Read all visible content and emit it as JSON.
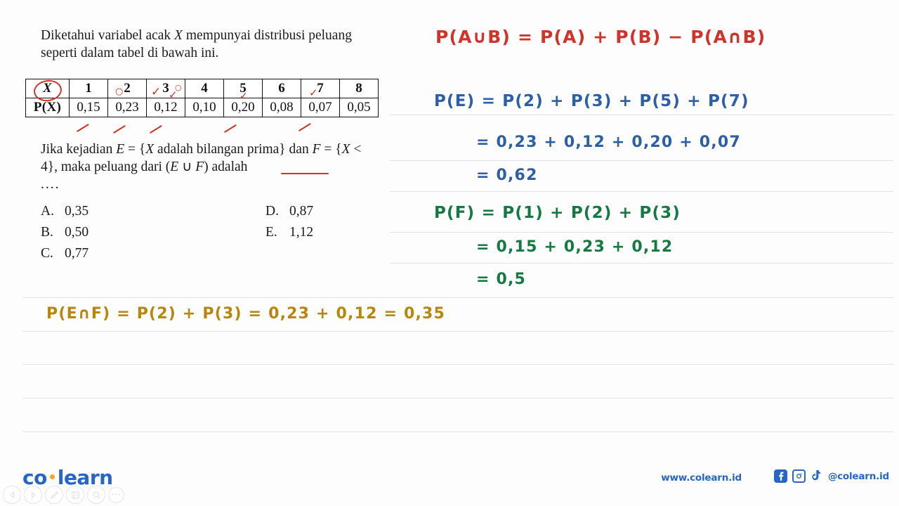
{
  "question": {
    "line1_pre": "Diketahui variabel acak ",
    "line1_var": "X",
    "line1_post": " mempunyai distribusi",
    "line2": "peluang seperti dalam tabel di bawah ini.",
    "prompt_line1_a": "Jika kejadian ",
    "prompt_E": "E",
    "prompt_line1_b": " = {",
    "prompt_X1": "X",
    "prompt_line1_c": " adalah bilangan prima} dan",
    "prompt_F": "F",
    "prompt_line2_a": " = {",
    "prompt_X2": "X",
    "prompt_line2_b": " < 4}, maka peluang dari (",
    "prompt_EUF_E": "E",
    "prompt_union": " ∪ ",
    "prompt_EUF_F": "F",
    "prompt_line2_c": ") adalah",
    "ellipsis": "...."
  },
  "table": {
    "header_x": "X",
    "header_px": "P(X)",
    "x_values": [
      "1",
      "2",
      "3",
      "4",
      "5",
      "6",
      "7",
      "8"
    ],
    "p_values": [
      "0,15",
      "0,23",
      "0,12",
      "0,10",
      "0,20",
      "0,08",
      "0,07",
      "0,05"
    ]
  },
  "choices": {
    "left": [
      {
        "label": "A.",
        "value": "0,35"
      },
      {
        "label": "B.",
        "value": "0,50"
      },
      {
        "label": "C.",
        "value": "0,77"
      }
    ],
    "right": [
      {
        "label": "D.",
        "value": "0,87"
      },
      {
        "label": "E.",
        "value": "1,12"
      }
    ]
  },
  "annotations": {
    "x_circle": "circle-around-X",
    "marks": [
      "o",
      "6",
      "○",
      "✓",
      "✓",
      "✓"
    ],
    "underline_euf": "red-underline-E-union-F"
  },
  "work": {
    "formula_red": "P(A∪B) = P(A) + P(B) − P(A∩B)",
    "pe_line1": "P(E) =   P(2) + P(3) + P(5) + P(7)",
    "pe_line2": "=  0,23 +  0,12 +  0,20 +  0,07",
    "pe_line3": "=  0,62",
    "pf_line1": "P(F) =   P(1) + P(2) + P(3)",
    "pf_line2": "=  0,15 + 0,23 + 0,12",
    "pf_line3": "=  0,5",
    "penf_line": "P(E∩F)  =  P(2) + P(3)  =  0,23 + 0,12  =  0,35"
  },
  "footer": {
    "logo_co": "co",
    "logo_learn": "learn",
    "url": "www.colearn.id",
    "handle": "@colearn.id",
    "facebook_glyph": "f",
    "instagram_glyph": "◎",
    "tiktok_glyph": "♪"
  },
  "toolbar": {
    "prev": "◁",
    "next": "▷",
    "pen": "✒",
    "notes": "☰",
    "search": "⌕",
    "more": "•••"
  },
  "colors": {
    "red_ink": "#d0332a",
    "blue_ink": "#2b5fa8",
    "green_ink": "#137a42",
    "gold_ink": "#b8860b",
    "brand_blue": "#2566c8",
    "brand_orange": "#f5a623",
    "rule_line": "#dfe2e6"
  }
}
